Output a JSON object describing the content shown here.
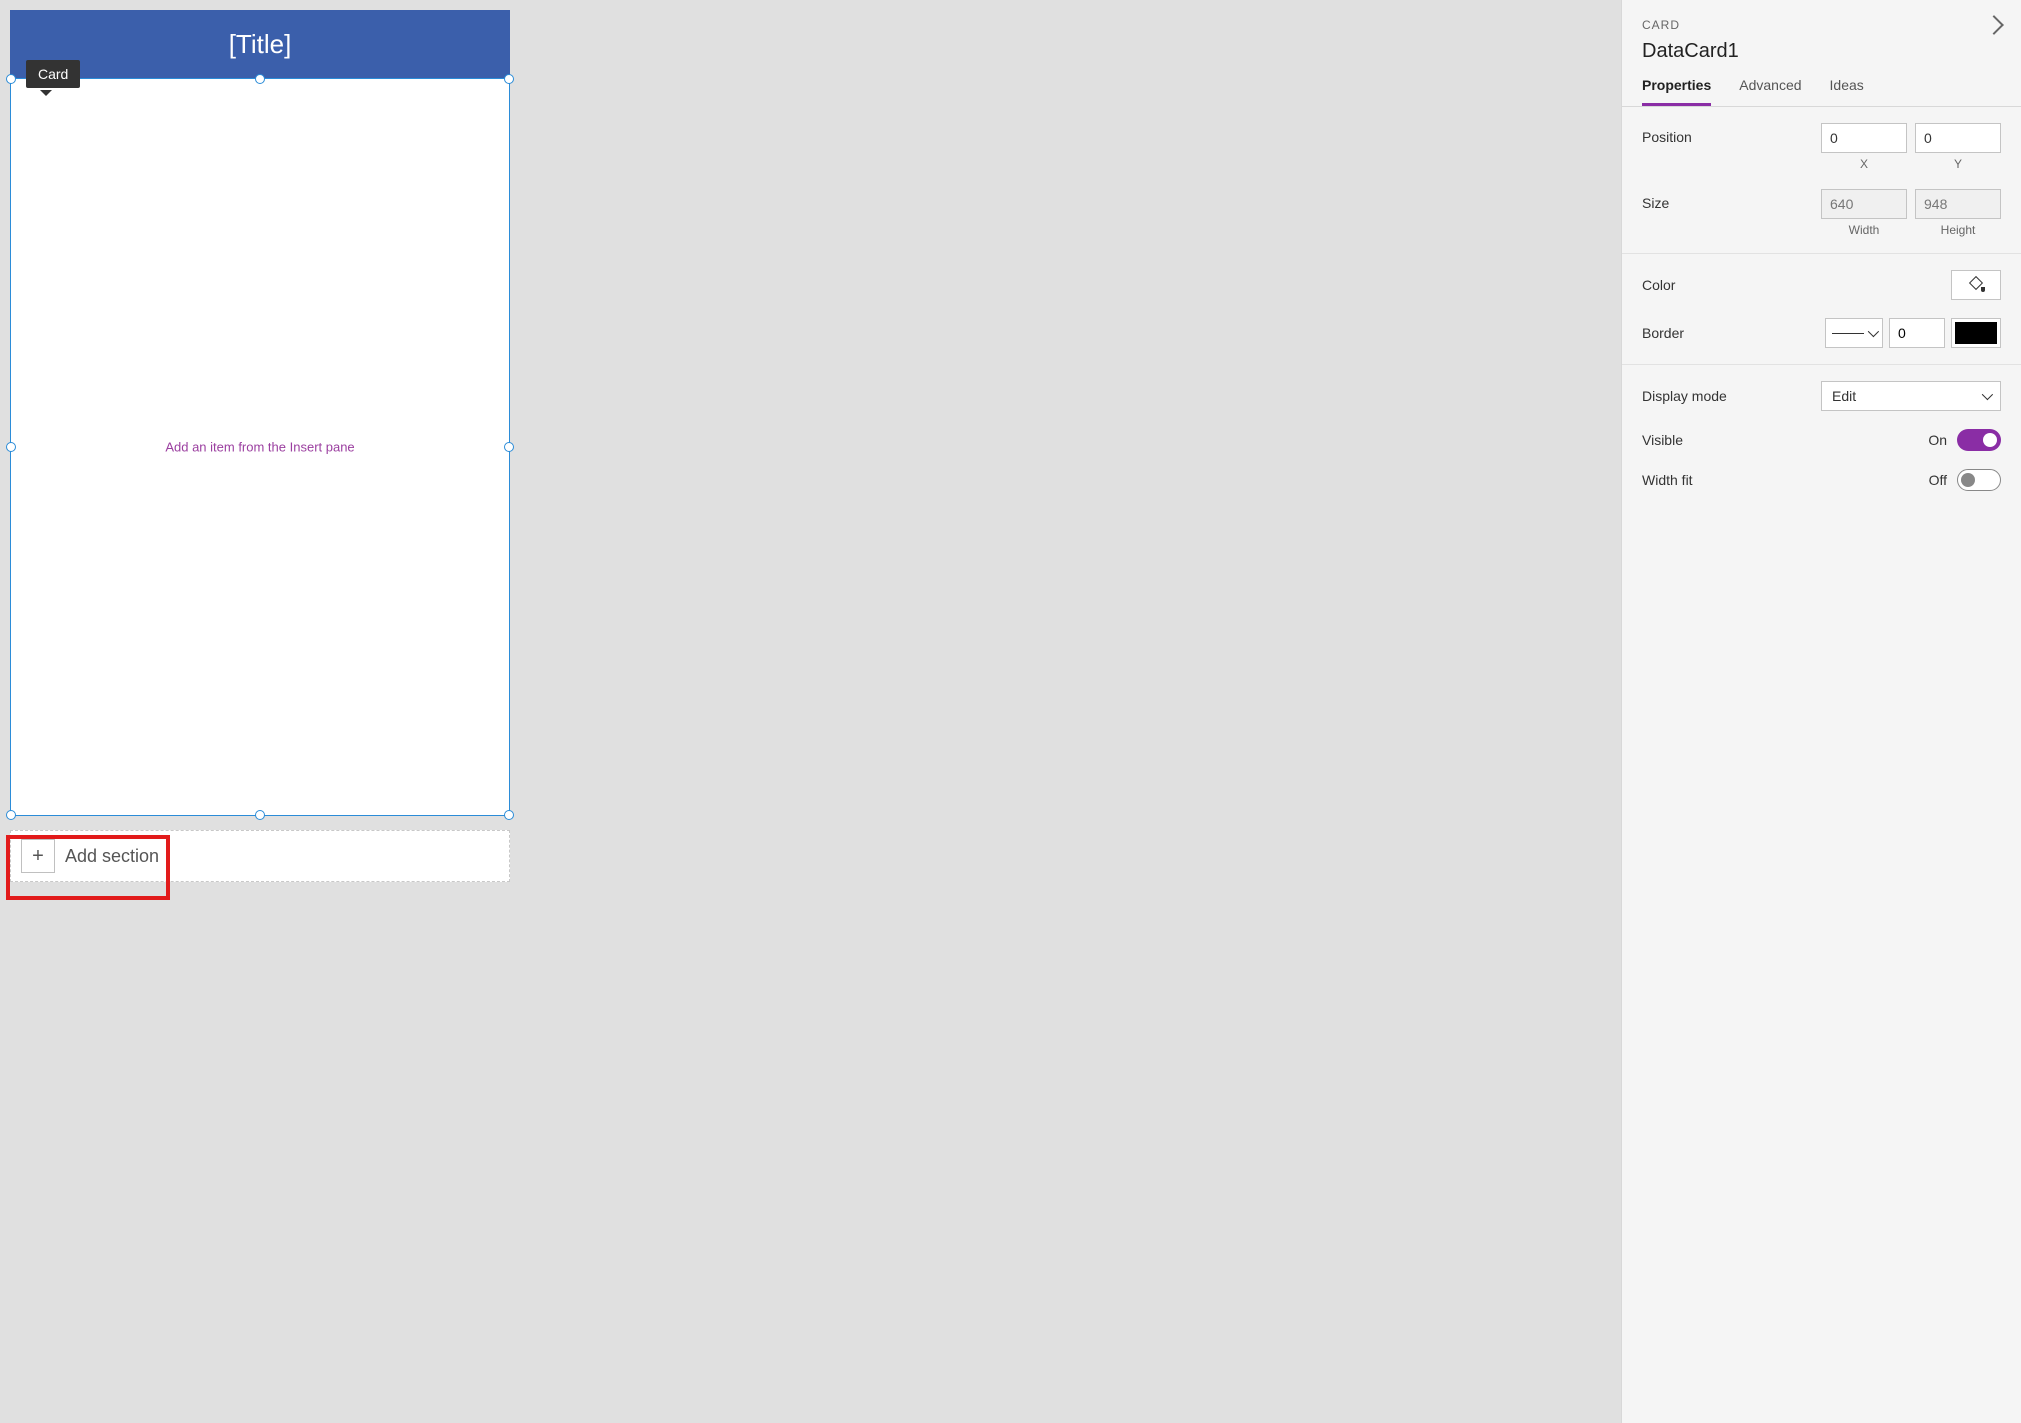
{
  "canvas": {
    "tooltip_label": "Card",
    "title": "[Title]",
    "body_placeholder": "Add an item from the Insert pane",
    "add_section_label": "Add section"
  },
  "panel": {
    "category": "CARD",
    "name": "DataCard1",
    "tabs": {
      "properties": "Properties",
      "advanced": "Advanced",
      "ideas": "Ideas"
    },
    "position": {
      "label": "Position",
      "x": "0",
      "y": "0",
      "x_label": "X",
      "y_label": "Y"
    },
    "size": {
      "label": "Size",
      "width": "640",
      "height": "948",
      "width_label": "Width",
      "height_label": "Height"
    },
    "color_label": "Color",
    "border": {
      "label": "Border",
      "width": "0",
      "color": "#000000"
    },
    "display_mode": {
      "label": "Display mode",
      "value": "Edit"
    },
    "visible": {
      "label": "Visible",
      "state_text": "On",
      "on": true
    },
    "width_fit": {
      "label": "Width fit",
      "state_text": "Off",
      "on": false
    }
  }
}
